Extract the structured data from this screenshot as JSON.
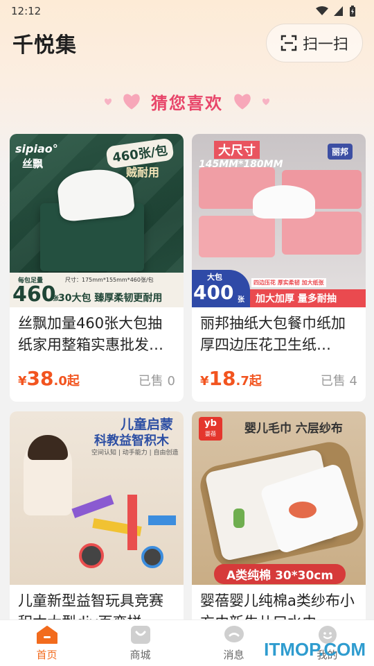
{
  "status": {
    "time": "12:12",
    "icons": [
      "wifi-icon",
      "signal-icon",
      "battery-icon"
    ]
  },
  "header": {
    "title": "千悦集",
    "scan_label": "扫一扫",
    "scan_icon": "scan-icon"
  },
  "section": {
    "title": "猜您喜欢"
  },
  "products": [
    {
      "title": "丝飘加量460张大包抽纸家用整箱实惠批发…",
      "price": {
        "currency": "¥",
        "integer": "38",
        "decimal": ".0",
        "suffix": "起"
      },
      "sold": "已售 0",
      "image": {
        "brand": "sipiao°",
        "brand_cn": "丝飘",
        "badge": "460张/包",
        "badge2": "贼耐用",
        "size_note": "尺寸：175mm*155mm*460张/包",
        "count_small": "每包足量",
        "count": "460",
        "count_unit": "张",
        "banner": "30大包 臻厚柔韧更耐用"
      }
    },
    {
      "title": "丽邦抽纸大包餐巾纸加厚四边压花卫生纸…",
      "price": {
        "currency": "¥",
        "integer": "18",
        "decimal": ".7",
        "suffix": "起"
      },
      "sold": "已售 4",
      "image": {
        "headline": "大尺寸",
        "dims": "145MM*180MM",
        "brand": "丽邦",
        "count_small": "大包",
        "count": "400",
        "count_unit": "张",
        "tag": "四边压花 厚实柔韧 加大纸张",
        "banner": "加大加厚 量多耐抽"
      }
    },
    {
      "title": "儿童新型益智玩具竞赛积木大型diy百变拼",
      "image": {
        "headline1": "儿童启蒙",
        "headline2": "科教益智积木",
        "tags": "空间认知 | 动手能力 | 自由创造"
      }
    },
    {
      "title": "婴蓓婴儿纯棉a类纱布小方巾新生儿口水巾",
      "image": {
        "logo": "yb",
        "logo_cn": "婴蓓",
        "headline": "婴儿毛巾 六层纱布",
        "banner": "A类纯棉 30*30cm"
      }
    }
  ],
  "tabbar": [
    {
      "label": "首页",
      "icon": "home-icon",
      "active": true
    },
    {
      "label": "商城",
      "icon": "shop-icon",
      "active": false
    },
    {
      "label": "消息",
      "icon": "message-icon",
      "active": false
    },
    {
      "label": "我的",
      "icon": "profile-icon",
      "active": false
    }
  ],
  "watermark": "ITMOP.COM",
  "colors": {
    "accent": "#f26b1d",
    "price": "#f2541f",
    "section_title": "#e8466a",
    "heart": "#f7a7b9"
  }
}
